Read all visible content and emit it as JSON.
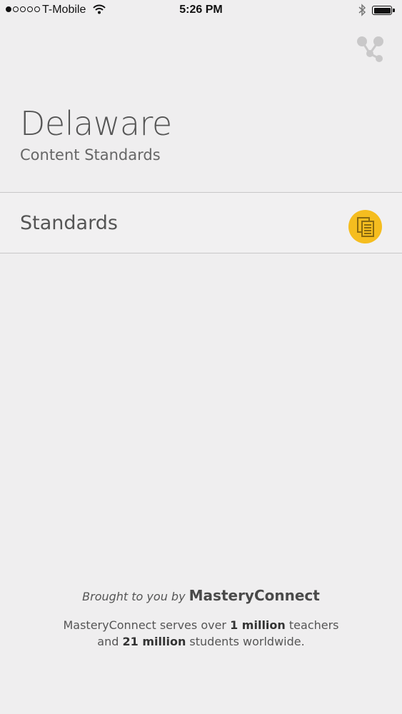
{
  "status_bar": {
    "carrier": "T-Mobile",
    "time": "5:26 PM",
    "signal_bars_filled": 1,
    "signal_bars_total": 5
  },
  "header": {
    "share_icon": "share-icon",
    "title": "Delaware",
    "subtitle": "Content Standards"
  },
  "list": {
    "items": [
      {
        "label": "Standards",
        "icon": "documents-icon",
        "icon_color": "#f5bd1f"
      }
    ]
  },
  "footer": {
    "brought_prefix": "Brought to you by",
    "brand": "MasteryConnect",
    "line1_prefix": "MasteryConnect serves over",
    "line1_bold": "1 million",
    "line1_suffix": "teachers",
    "line2_prefix": "and",
    "line2_bold": "21 million",
    "line2_suffix": "students worldwide."
  }
}
